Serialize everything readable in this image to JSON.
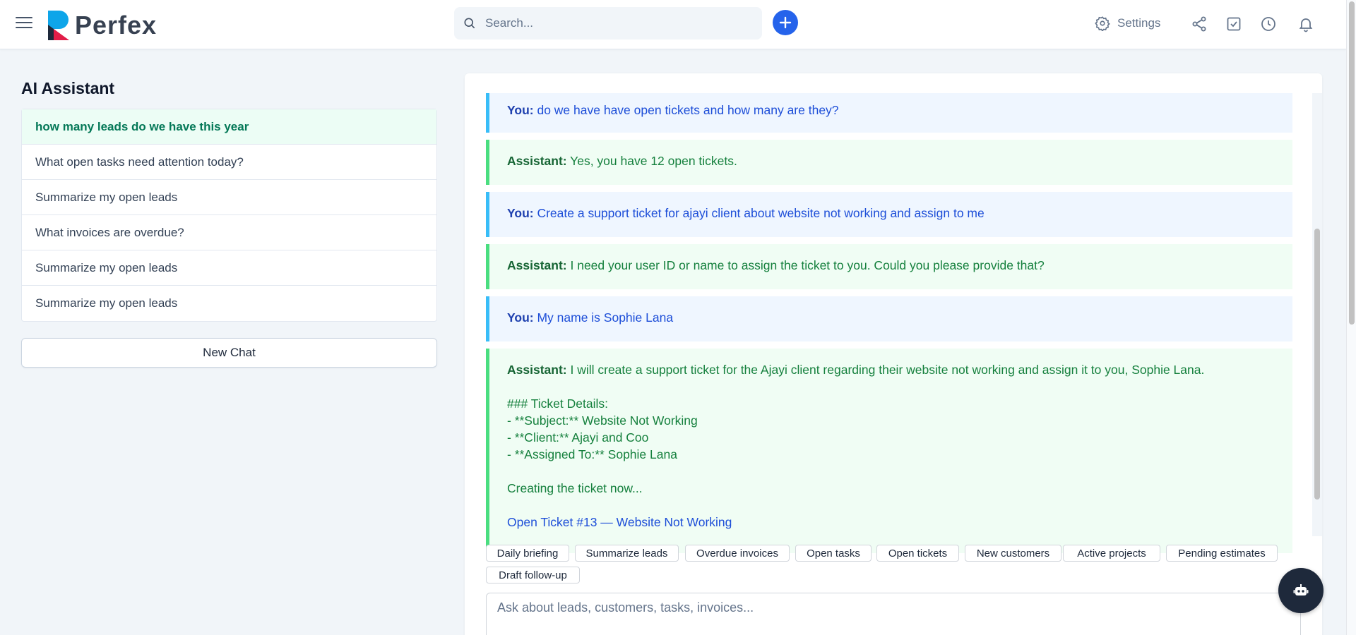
{
  "header": {
    "brand": "Perfex",
    "search_placeholder": "Search...",
    "settings_label": "Settings",
    "icons": [
      "menu-icon",
      "search-icon",
      "plus-icon",
      "gear-icon",
      "share-icon",
      "checkbox-icon",
      "clock-icon",
      "bell-icon"
    ],
    "accent_color": "#2563eb"
  },
  "sidebar": {
    "title": "AI Assistant",
    "history": [
      {
        "label": "how many leads do we have this year",
        "active": true
      },
      {
        "label": "What open tasks need attention today?"
      },
      {
        "label": "Summarize my open leads"
      },
      {
        "label": "What invoices are overdue?"
      },
      {
        "label": "Summarize my open leads"
      },
      {
        "label": "Summarize my open leads"
      }
    ],
    "new_chat_label": "New Chat"
  },
  "chat": {
    "messages": [
      {
        "role": "user",
        "speaker": "You:",
        "text": "do we have have open tickets and how many are they?"
      },
      {
        "role": "assistant",
        "speaker": "Assistant:",
        "text": "Yes, you have 12 open tickets."
      },
      {
        "role": "user",
        "speaker": "You:",
        "text": "Create a support ticket for ajayi client about website not working and assign to me"
      },
      {
        "role": "assistant",
        "speaker": "Assistant:",
        "text": "I need your user ID or name to assign the ticket to you. Could you please provide that?"
      },
      {
        "role": "user",
        "speaker": "You:",
        "text": "My name is Sophie Lana"
      },
      {
        "role": "assistant",
        "speaker": "Assistant:",
        "text": "I will create a support ticket for the Ajayi client regarding their website not working and assign it to you, Sophie Lana.",
        "lines": [
          "### Ticket Details:",
          "- **Subject:** Website Not Working",
          "- **Client:** Ajayi and Coo",
          "- **Assigned To:** Sophie Lana",
          "Creating the ticket now..."
        ],
        "link": "Open Ticket #13 — Website Not Working"
      }
    ],
    "suggestions": [
      "Daily briefing",
      "Summarize leads",
      "Overdue invoices",
      "Open tasks",
      "Open tickets",
      "New customers",
      "Active projects",
      "Pending estimates",
      "Draft follow-up"
    ],
    "input_placeholder": "Ask about leads, customers, tasks, invoices...",
    "colors": {
      "user_bg": "#eff6ff",
      "user_border": "#38bdf8",
      "assistant_bg": "#f0fdf4",
      "assistant_border": "#4ade80"
    }
  },
  "assistant_button": {
    "icon": "robot-icon"
  }
}
